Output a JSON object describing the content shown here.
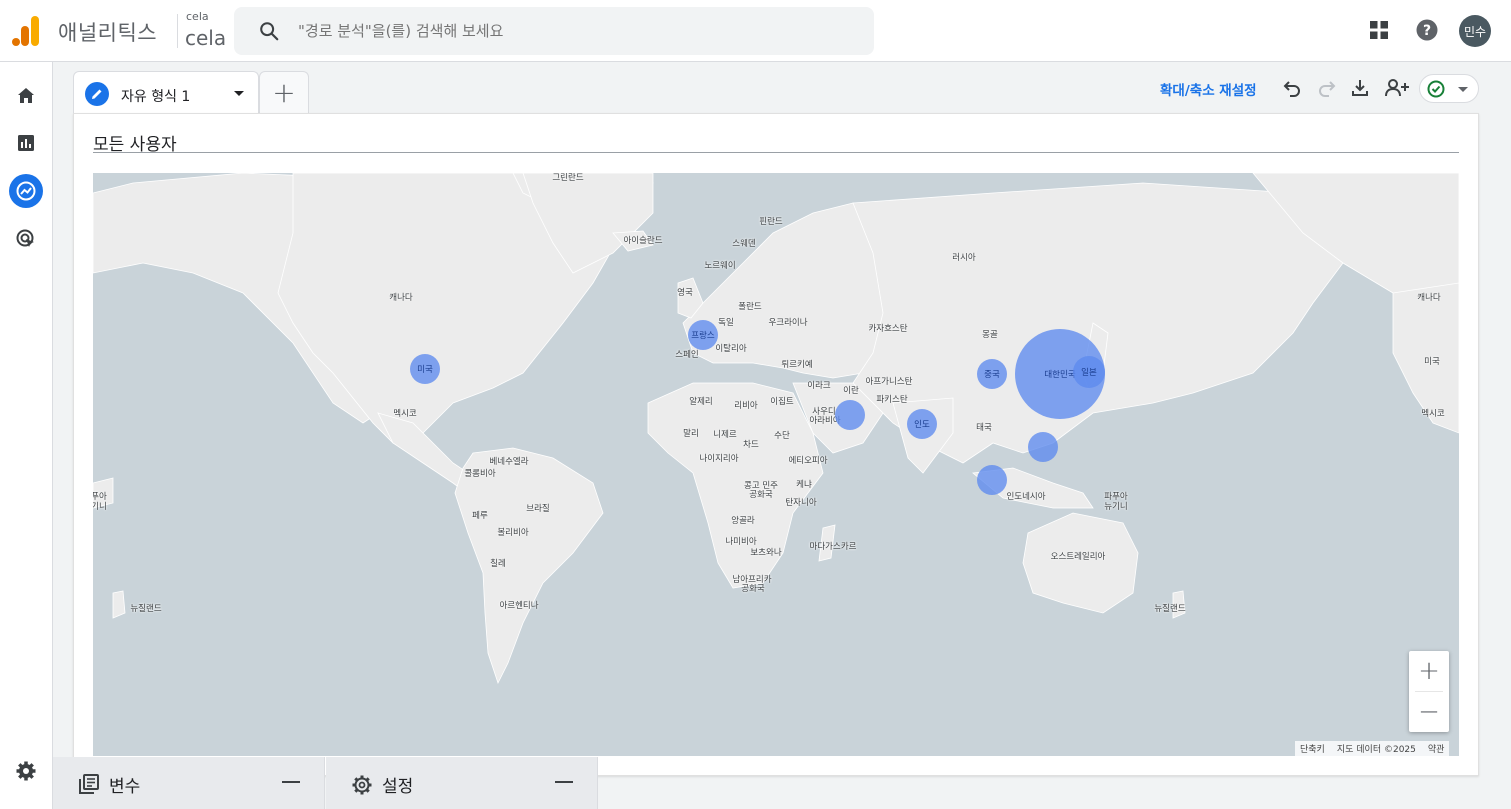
{
  "header": {
    "product_name": "애널리틱스",
    "account_small": "cela",
    "account_big": "cela",
    "search_placeholder": "\"경로 분석\"을(를) 검색해 보세요",
    "avatar_text": "민수"
  },
  "sidenav": {
    "items": [
      "home-icon",
      "reports-icon",
      "explore-icon",
      "advertising-icon"
    ],
    "settings_icon": "gear-icon",
    "active": "explore-icon"
  },
  "tabs": {
    "active_label": "자유 형식 1",
    "add_label": "+"
  },
  "toolbar": {
    "reset_zoom_label": "확대/축소 재설정",
    "icons": [
      "undo-icon",
      "redo-icon",
      "download-icon",
      "share-user-icon",
      "check-circle-icon"
    ]
  },
  "segment": {
    "title": "모든 사용자"
  },
  "map": {
    "labels": [
      {
        "text": "그린란드",
        "id": "greenland"
      },
      {
        "text": "아이슬란드",
        "id": "iceland"
      },
      {
        "text": "핀란드",
        "id": "finland"
      },
      {
        "text": "스웨덴",
        "id": "sweden"
      },
      {
        "text": "노르웨이",
        "id": "norway"
      },
      {
        "text": "러시아",
        "id": "russia"
      },
      {
        "text": "영국",
        "id": "uk"
      },
      {
        "text": "폴란드",
        "id": "poland"
      },
      {
        "text": "독일",
        "id": "germany"
      },
      {
        "text": "우크라이나",
        "id": "ukraine"
      },
      {
        "text": "이탈리아",
        "id": "italy"
      },
      {
        "text": "스페인",
        "id": "spain"
      },
      {
        "text": "카자흐스탄",
        "id": "kazakhstan"
      },
      {
        "text": "몽골",
        "id": "mongolia"
      },
      {
        "text": "튀르키예",
        "id": "turkey"
      },
      {
        "text": "이라크",
        "id": "iraq"
      },
      {
        "text": "이란",
        "id": "iran"
      },
      {
        "text": "아프가니스탄",
        "id": "afghanistan"
      },
      {
        "text": "파키스탄",
        "id": "pakistan"
      },
      {
        "text": "알제리",
        "id": "algeria"
      },
      {
        "text": "리비아",
        "id": "libya"
      },
      {
        "text": "이집트",
        "id": "egypt"
      },
      {
        "text": "사우디",
        "id": "saudi1"
      },
      {
        "text": "아라비아",
        "id": "saudi2"
      },
      {
        "text": "태국",
        "id": "thailand"
      },
      {
        "text": "말리",
        "id": "mali"
      },
      {
        "text": "니제르",
        "id": "niger"
      },
      {
        "text": "차드",
        "id": "chad"
      },
      {
        "text": "수단",
        "id": "sudan"
      },
      {
        "text": "나이지리아",
        "id": "nigeria"
      },
      {
        "text": "에티오피아",
        "id": "ethiopia"
      },
      {
        "text": "콩고 민주",
        "id": "drc1"
      },
      {
        "text": "공화국",
        "id": "drc2"
      },
      {
        "text": "케냐",
        "id": "kenya"
      },
      {
        "text": "탄자니아",
        "id": "tanzania"
      },
      {
        "text": "앙골라",
        "id": "angola"
      },
      {
        "text": "나미비아",
        "id": "namibia"
      },
      {
        "text": "보츠와나",
        "id": "botswana"
      },
      {
        "text": "마다가스카르",
        "id": "madagascar"
      },
      {
        "text": "남아프리카",
        "id": "southafrica1"
      },
      {
        "text": "공화국",
        "id": "southafrica2"
      },
      {
        "text": "인도네시아",
        "id": "indonesia"
      },
      {
        "text": "파푸아",
        "id": "png1"
      },
      {
        "text": "뉴기니",
        "id": "png2"
      },
      {
        "text": "오스트레일리아",
        "id": "australia"
      },
      {
        "text": "뉴질랜드",
        "id": "nz_right"
      },
      {
        "text": "뉴질랜드",
        "id": "nz_left"
      },
      {
        "text": "캐나다",
        "id": "canada_left"
      },
      {
        "text": "캐나다",
        "id": "canada_right"
      },
      {
        "text": "미국",
        "id": "usa_right"
      },
      {
        "text": "멕시코",
        "id": "mexico_left"
      },
      {
        "text": "멕시코",
        "id": "mexico_right"
      },
      {
        "text": "베네수엘라",
        "id": "venezuela"
      },
      {
        "text": "콜롬비아",
        "id": "colombia"
      },
      {
        "text": "페루",
        "id": "peru"
      },
      {
        "text": "브라질",
        "id": "brazil"
      },
      {
        "text": "볼리비아",
        "id": "bolivia"
      },
      {
        "text": "칠레",
        "id": "chile"
      },
      {
        "text": "아르헨티나",
        "id": "argentina"
      },
      {
        "text": "푸아",
        "id": "edge_png1"
      },
      {
        "text": "기니",
        "id": "edge_png2"
      }
    ],
    "bubbles": [
      {
        "label": "대한민국",
        "id": "korea"
      },
      {
        "label": "일본",
        "id": "japan"
      },
      {
        "label": "중국",
        "id": "china"
      },
      {
        "label": "인도",
        "id": "india"
      },
      {
        "label": "프랑스",
        "id": "france"
      },
      {
        "label": "미국",
        "id": "usa"
      },
      {
        "label": "",
        "id": "uae"
      },
      {
        "label": "",
        "id": "philippines"
      },
      {
        "label": "",
        "id": "indonesia_west"
      }
    ],
    "zoom_in_label": "+",
    "zoom_out_label": "−",
    "attribution": {
      "shortcuts": "단축키",
      "map_data": "지도 데이터 ©2025",
      "terms": "약관"
    }
  },
  "bottom": {
    "variables_label": "변수",
    "settings_label": "설정",
    "collapse_icon": "minus-icon"
  },
  "colors": {
    "accent": "#1a73e8",
    "bubble": "#5d8aee",
    "map_water": "#c9d3d9",
    "map_land": "#ececec"
  }
}
